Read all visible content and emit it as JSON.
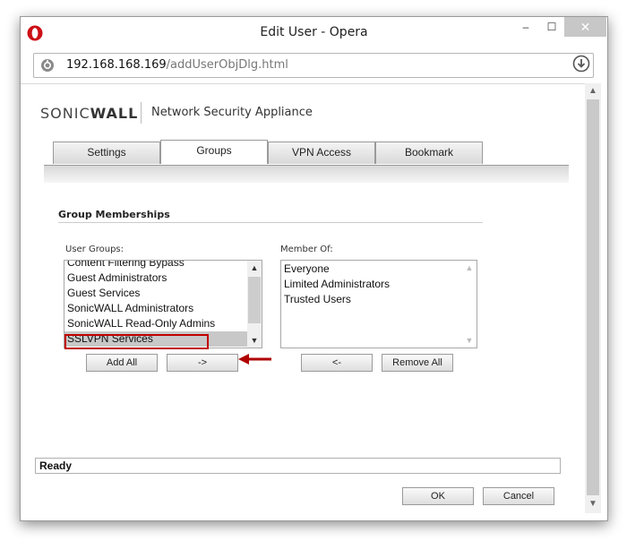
{
  "window": {
    "title": "Edit User - Opera",
    "minimize": "–",
    "maximize": "☐",
    "close": "✕"
  },
  "addressbar": {
    "host": "192.168.168.169",
    "path": "/addUserObjDlg.html"
  },
  "brand": {
    "logo_part1": "SONIC",
    "logo_part2": "WALL",
    "tagline": "Network Security Appliance"
  },
  "tabs": [
    {
      "label": "Settings",
      "active": false
    },
    {
      "label": "Groups",
      "active": true
    },
    {
      "label": "VPN Access",
      "active": false
    },
    {
      "label": "Bookmark",
      "active": false
    }
  ],
  "section": {
    "title": "Group Memberships"
  },
  "user_groups": {
    "label": "User Groups:",
    "items": [
      "Content Filtering Bypass",
      "Guest Administrators",
      "Guest Services",
      "SonicWALL Administrators",
      "SonicWALL Read-Only Admins",
      "SSLVPN Services"
    ],
    "selected": "SSLVPN Services"
  },
  "member_of": {
    "label": "Member Of:",
    "items": [
      "Everyone",
      "Limited Administrators",
      "Trusted Users"
    ]
  },
  "buttons": {
    "add_all": "Add All",
    "add": "->",
    "remove": "<-",
    "remove_all": "Remove All",
    "ok": "OK",
    "cancel": "Cancel"
  },
  "status": "Ready",
  "colors": {
    "highlight": "#c00000",
    "arrow": "#b00000",
    "opera_red": "#cc0f16"
  }
}
